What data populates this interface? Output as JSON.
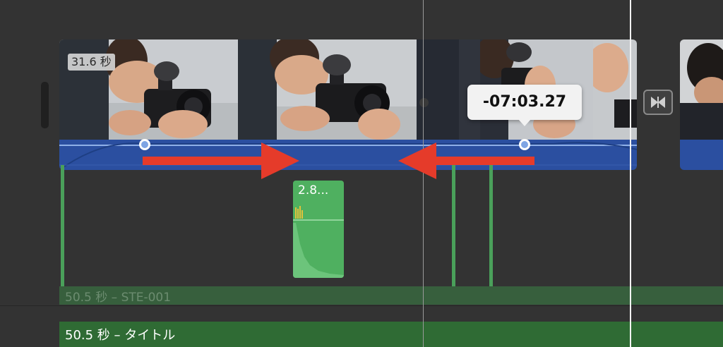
{
  "timeline": {
    "main_clip": {
      "duration_badge": "31.6 秒"
    },
    "time_tooltip": "-07:03.27",
    "sound_effect_clip": {
      "label": "2.8..."
    },
    "background_audio": {
      "label": "50.5 秒 – STE-001"
    },
    "title_clip": {
      "label": "50.5 秒 – タイトル"
    }
  },
  "colors": {
    "timeline_bg": "#333333",
    "audio_band": "#2b4fa0",
    "marker_green": "#4aa05a",
    "title_track": "#2f6b34",
    "arrow_red": "#e53b2a"
  },
  "icons": {
    "transition": "transition-icon",
    "keyframe": "keyframe-dot"
  }
}
